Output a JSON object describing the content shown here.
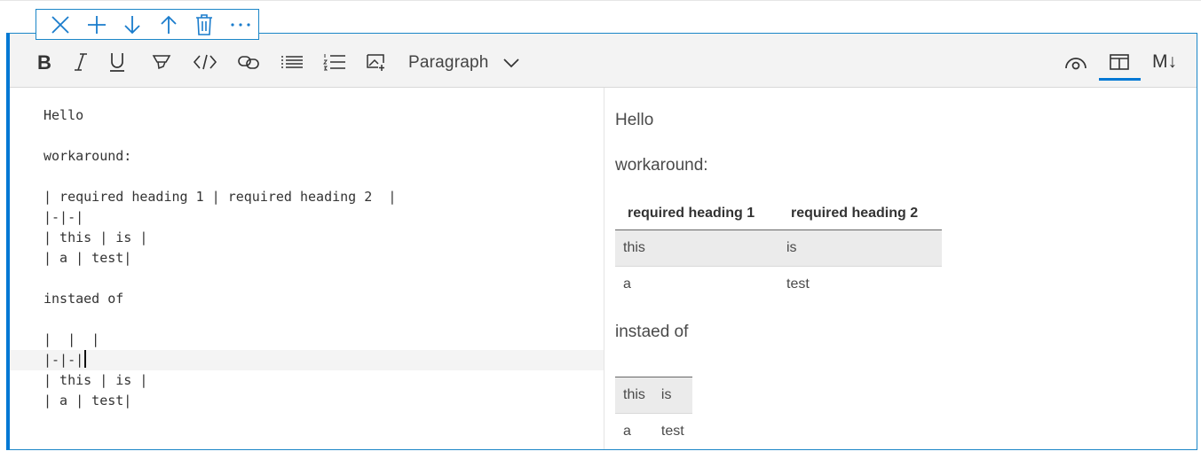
{
  "icons": {
    "toolbar": [
      "close-icon",
      "add-icon",
      "move-down-icon",
      "move-up-icon",
      "delete-icon",
      "more-icon"
    ],
    "format": [
      "bold-icon",
      "italic-icon",
      "underline-icon",
      "highlight-icon",
      "code-icon",
      "link-icon",
      "bullet-list-icon",
      "numbered-list-icon",
      "image-icon"
    ],
    "view": [
      "preview-icon",
      "split-view-icon",
      "markdown-icon"
    ]
  },
  "format_bar": {
    "block_type": "Paragraph",
    "markdown_label": "M↓"
  },
  "source": {
    "lines": [
      "Hello",
      "",
      "workaround:",
      "",
      "| required heading 1 | required heading 2  |",
      "|-|-|",
      "| this | is |",
      "| a | test|",
      "",
      "instaed of",
      "",
      "|  |  |",
      "|-|-|",
      "| this | is |",
      "| a | test|"
    ]
  },
  "preview": {
    "p1": "Hello",
    "p2": "workaround:",
    "table1": {
      "headers": [
        "required heading 1",
        "required heading 2"
      ],
      "rows": [
        [
          "this",
          "is"
        ],
        [
          "a",
          "test"
        ]
      ]
    },
    "p3": "instaed of",
    "table2": {
      "headers": [
        "",
        ""
      ],
      "rows": [
        [
          "this",
          "is"
        ],
        [
          "a",
          "test"
        ]
      ]
    }
  },
  "colors": {
    "accent": "#0078d4",
    "border": "#1a86c8"
  }
}
